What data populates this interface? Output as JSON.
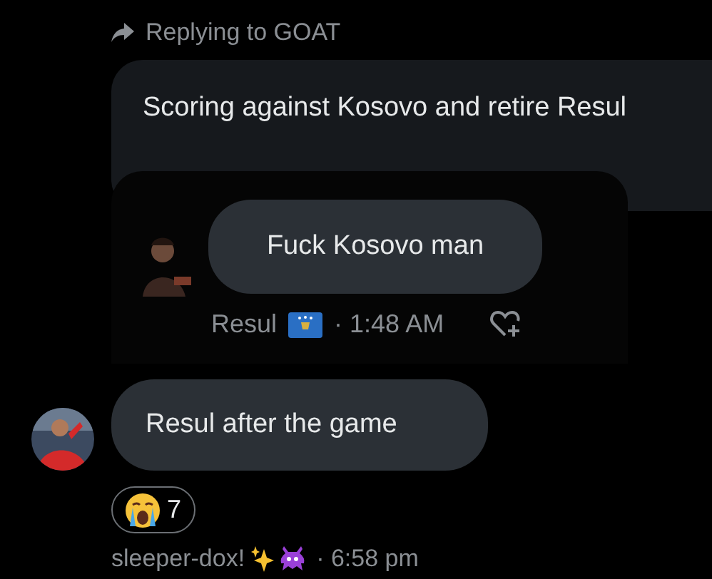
{
  "reply_header": {
    "label": "Replying to GOAT"
  },
  "replied_message": {
    "text": "Scoring against Kosovo and retire Resul",
    "quoted_screenshot": {
      "text": "Fuck Kosovo man",
      "sender": "Resul",
      "time": "· 1:48 AM"
    }
  },
  "message": {
    "text": "Resul after the game",
    "reactions": [
      {
        "count": "7"
      }
    ],
    "sender": "sleeper-dox!",
    "time": "· 6:58 pm"
  }
}
